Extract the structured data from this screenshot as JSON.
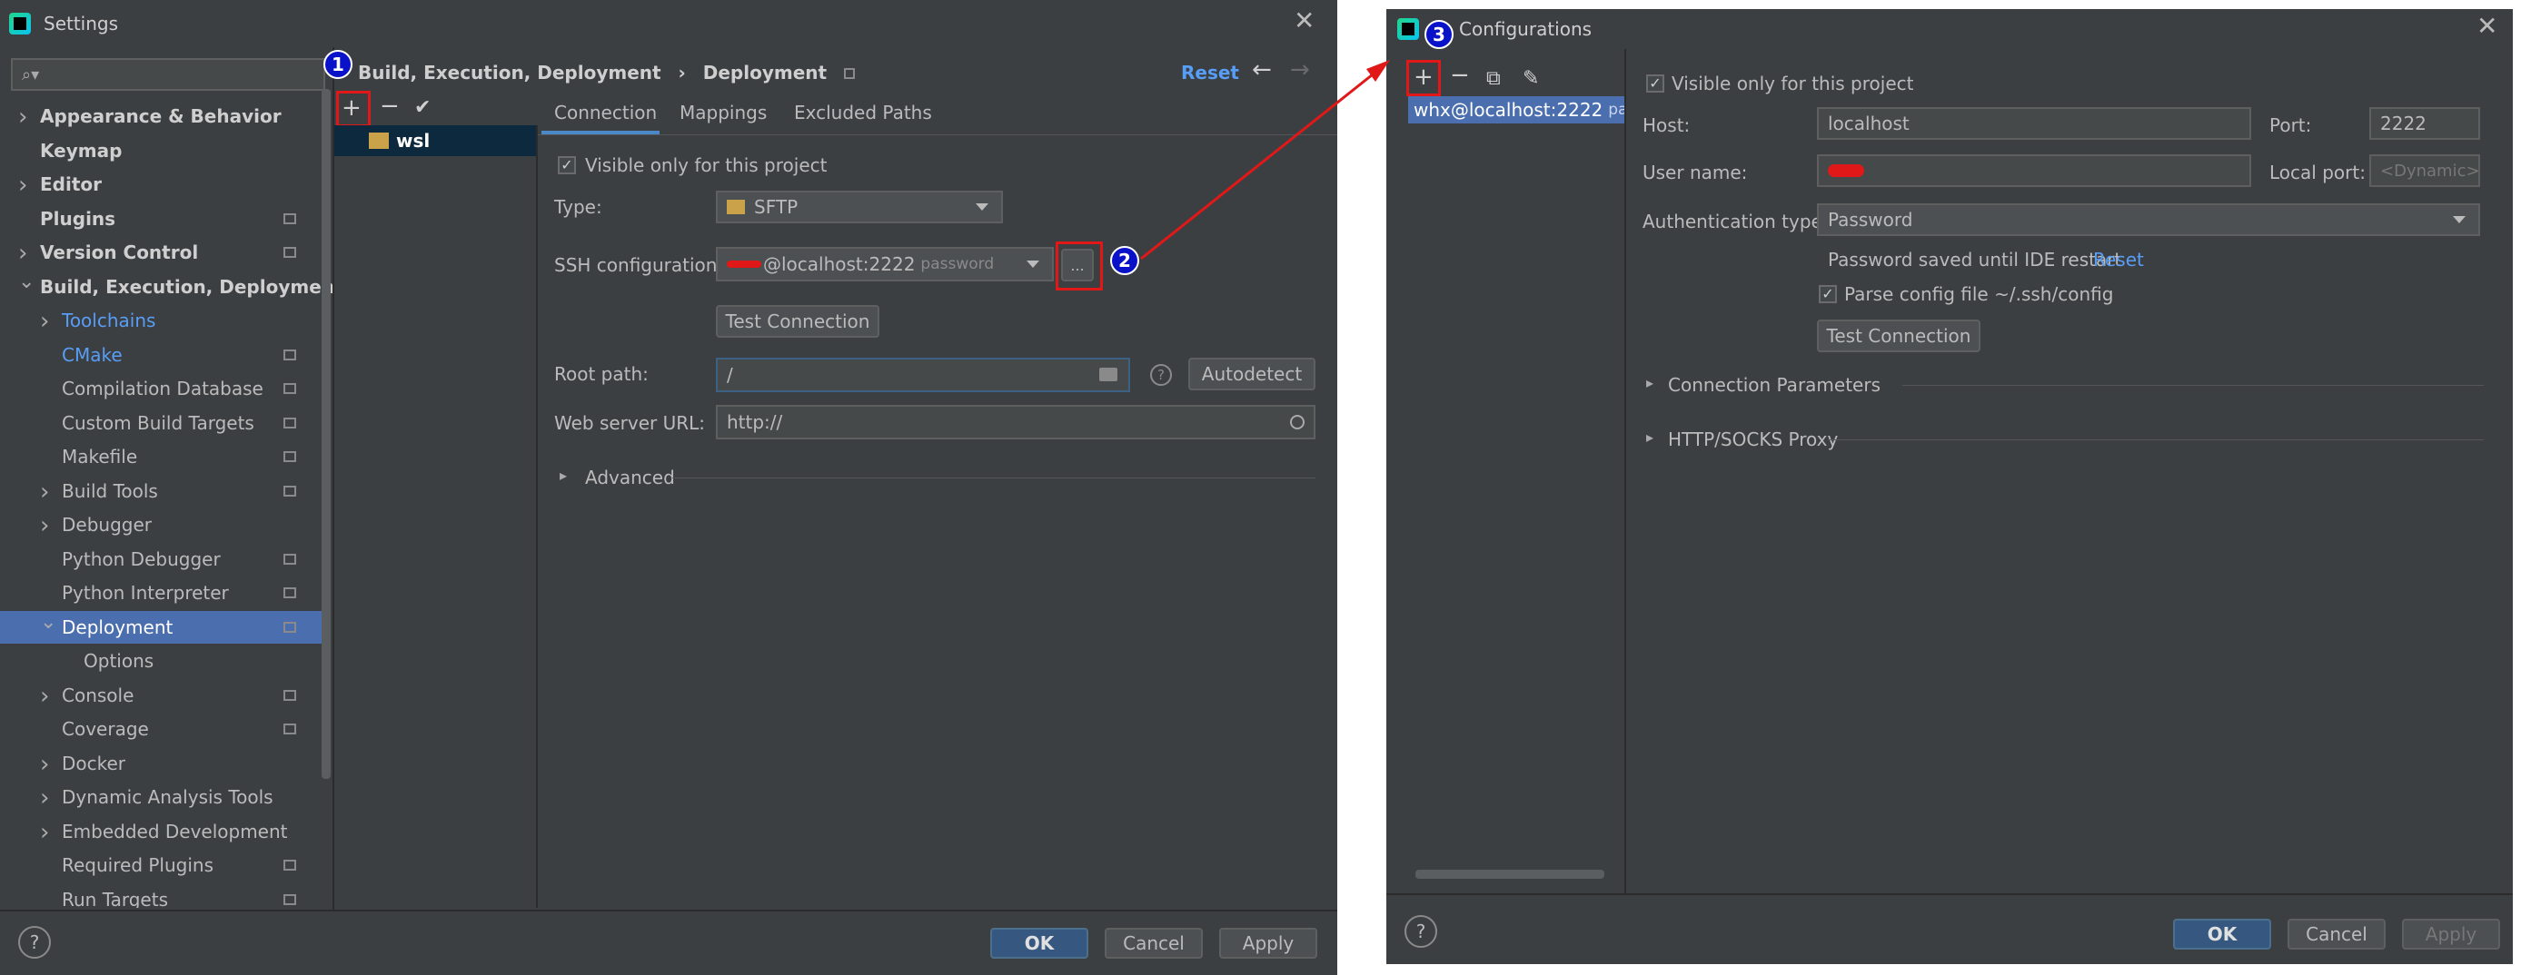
{
  "settings": {
    "title": "Settings",
    "search_placeholder": "",
    "tree": [
      {
        "label": "Appearance & Behavior",
        "bold": true,
        "expandable": true,
        "expanded": false,
        "level": 0
      },
      {
        "label": "Keymap",
        "bold": true,
        "level": 0
      },
      {
        "label": "Editor",
        "bold": true,
        "expandable": true,
        "expanded": false,
        "level": 0
      },
      {
        "label": "Plugins",
        "bold": true,
        "level": 0,
        "gear": true
      },
      {
        "label": "Version Control",
        "bold": true,
        "expandable": true,
        "expanded": false,
        "level": 0,
        "gear": true
      },
      {
        "label": "Build, Execution, Deployment",
        "bold": true,
        "expandable": true,
        "expanded": true,
        "level": 0
      },
      {
        "label": "Toolchains",
        "level": 1,
        "expandable": true,
        "expanded": false,
        "link": true
      },
      {
        "label": "CMake",
        "level": 1,
        "link": true,
        "gear": true
      },
      {
        "label": "Compilation Database",
        "level": 1,
        "gear": true
      },
      {
        "label": "Custom Build Targets",
        "level": 1,
        "gear": true
      },
      {
        "label": "Makefile",
        "level": 1,
        "gear": true
      },
      {
        "label": "Build Tools",
        "level": 1,
        "expandable": true,
        "expanded": false,
        "gear": true
      },
      {
        "label": "Debugger",
        "level": 1,
        "expandable": true,
        "expanded": false
      },
      {
        "label": "Python Debugger",
        "level": 1,
        "gear": true
      },
      {
        "label": "Python Interpreter",
        "level": 1,
        "gear": true
      },
      {
        "label": "Deployment",
        "level": 1,
        "expandable": true,
        "expanded": true,
        "gear": true,
        "selected": true
      },
      {
        "label": "Options",
        "level": 2
      },
      {
        "label": "Console",
        "level": 1,
        "expandable": true,
        "expanded": false,
        "gear": true
      },
      {
        "label": "Coverage",
        "level": 1,
        "gear": true
      },
      {
        "label": "Docker",
        "level": 1,
        "expandable": true,
        "expanded": false
      },
      {
        "label": "Dynamic Analysis Tools",
        "level": 1,
        "expandable": true,
        "expanded": false
      },
      {
        "label": "Embedded Development",
        "level": 1,
        "expandable": true,
        "expanded": false
      },
      {
        "label": "Required Plugins",
        "level": 1,
        "gear": true
      },
      {
        "label": "Run Targets",
        "level": 1,
        "gear": true
      }
    ],
    "breadcrumb": {
      "parent": "Build, Execution, Deployment",
      "separator": "›",
      "current": "Deployment"
    },
    "reset_label": "Reset",
    "server_name": "wsl",
    "tabs": [
      "Connection",
      "Mappings",
      "Excluded Paths"
    ],
    "visible_only_label": "Visible only for this project",
    "type_label": "Type:",
    "type_value": "SFTP",
    "ssh_label": "SSH configuration:",
    "ssh_value": "@localhost:2222",
    "ssh_hint": "password",
    "ellipsis": "...",
    "test_connection": "Test Connection",
    "root_path_label": "Root path:",
    "root_path_value": "/",
    "autodetect": "Autodetect",
    "web_url_label": "Web server URL:",
    "web_url_value": "http://",
    "advanced": "Advanced",
    "ok": "OK",
    "cancel": "Cancel",
    "apply": "Apply"
  },
  "configurations": {
    "title": "Configurations",
    "list_item": "whx@localhost:2222",
    "list_item_hint": "passwo",
    "visible_only_label": "Visible only for this project",
    "host_label": "Host:",
    "host_value": "localhost",
    "port_label": "Port:",
    "port_value": "2222",
    "user_label": "User name:",
    "local_port_label": "Local port:",
    "local_port_placeholder": "<Dynamic>",
    "auth_label": "Authentication type:",
    "auth_value": "Password",
    "password_saved": "Password saved until IDE restart",
    "reset_label": "Reset",
    "parse_config": "Parse config file ~/.ssh/config",
    "test_connection": "Test Connection",
    "connection_params": "Connection Parameters",
    "proxy": "HTTP/SOCKS Proxy",
    "ok": "OK",
    "cancel": "Cancel",
    "apply": "Apply"
  },
  "annotations": {
    "badge1": "1",
    "badge2": "2",
    "badge3": "3",
    "color": "#e01818"
  },
  "colors": {
    "background": "#3c3f41",
    "selection": "#4b6eaf",
    "link": "#589df6",
    "primary": "#365880"
  }
}
